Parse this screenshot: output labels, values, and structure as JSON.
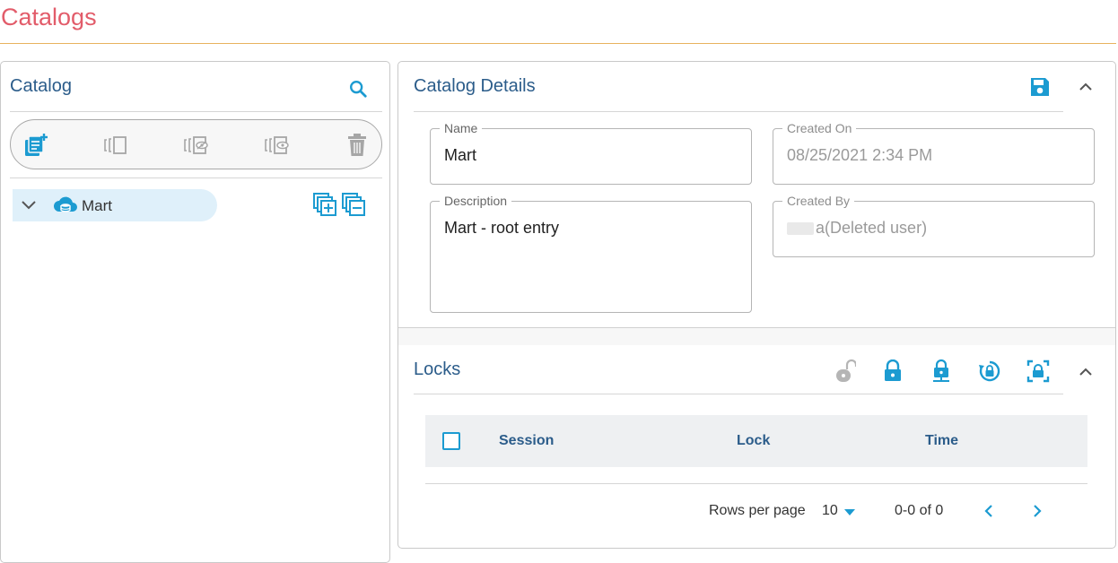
{
  "page": {
    "title": "Catalogs"
  },
  "catalog_panel": {
    "title": "Catalog",
    "tree": [
      {
        "label": "Mart"
      }
    ],
    "toolbar_icons": [
      "add-catalog-icon",
      "version-icon",
      "hide-icon",
      "show-icon",
      "trash-icon"
    ]
  },
  "details": {
    "title": "Catalog Details",
    "name": {
      "label": "Name",
      "value": "Mart"
    },
    "created_on": {
      "label": "Created On",
      "value": "08/25/2021 2:34 PM"
    },
    "description": {
      "label": "Description",
      "value": "Mart - root entry"
    },
    "created_by": {
      "label": "Created By",
      "value": "a(Deleted user)"
    }
  },
  "locks": {
    "title": "Locks",
    "columns": [
      "Session",
      "Lock",
      "Time"
    ],
    "rows": [],
    "pagination": {
      "rows_per_page_label": "Rows per page",
      "rows_per_page": "10",
      "range": "0-0 of 0"
    }
  },
  "colors": {
    "accent": "#1c9bd1",
    "title": "#e25c6a",
    "heading": "#2b5c8a",
    "rule": "#e8b25e"
  }
}
